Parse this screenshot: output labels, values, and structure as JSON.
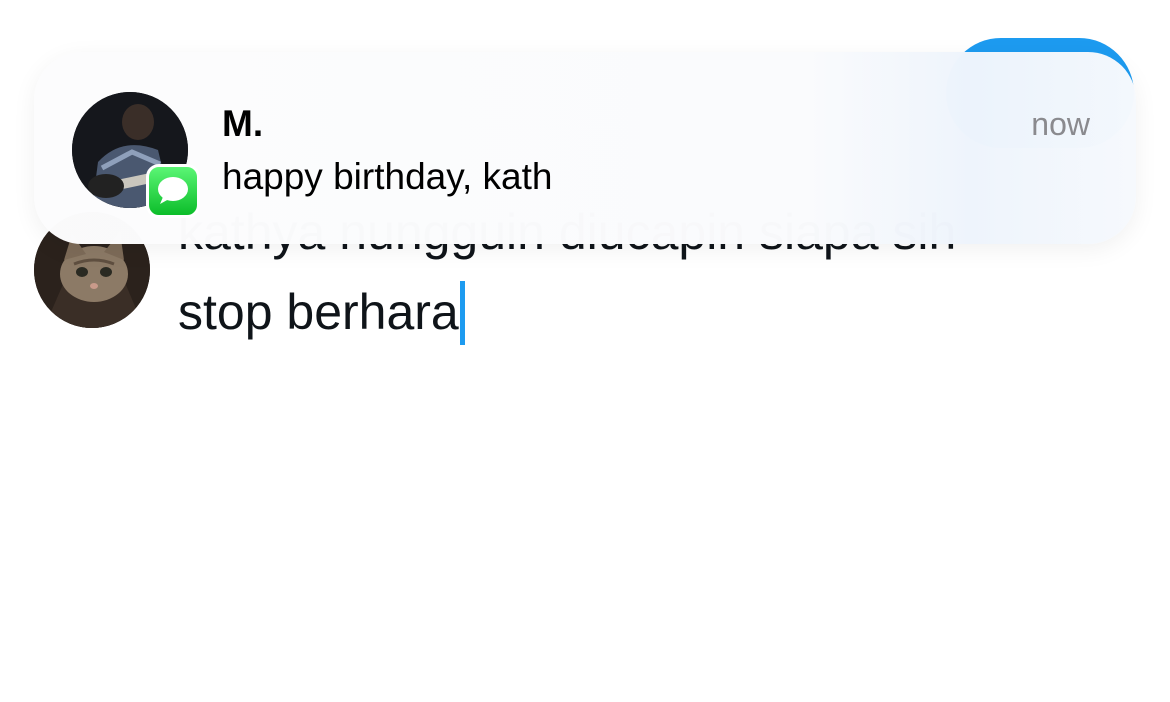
{
  "composer": {
    "text_lines": [
      "kathya nungguin diucapin siapa sih",
      "stop berhara"
    ],
    "accent_color": "#1d9bf0"
  },
  "notification": {
    "sender": "M.",
    "message": "happy birthday, kath",
    "time": "now",
    "app_icon": "messages-icon",
    "badge_color": "#34c759"
  }
}
